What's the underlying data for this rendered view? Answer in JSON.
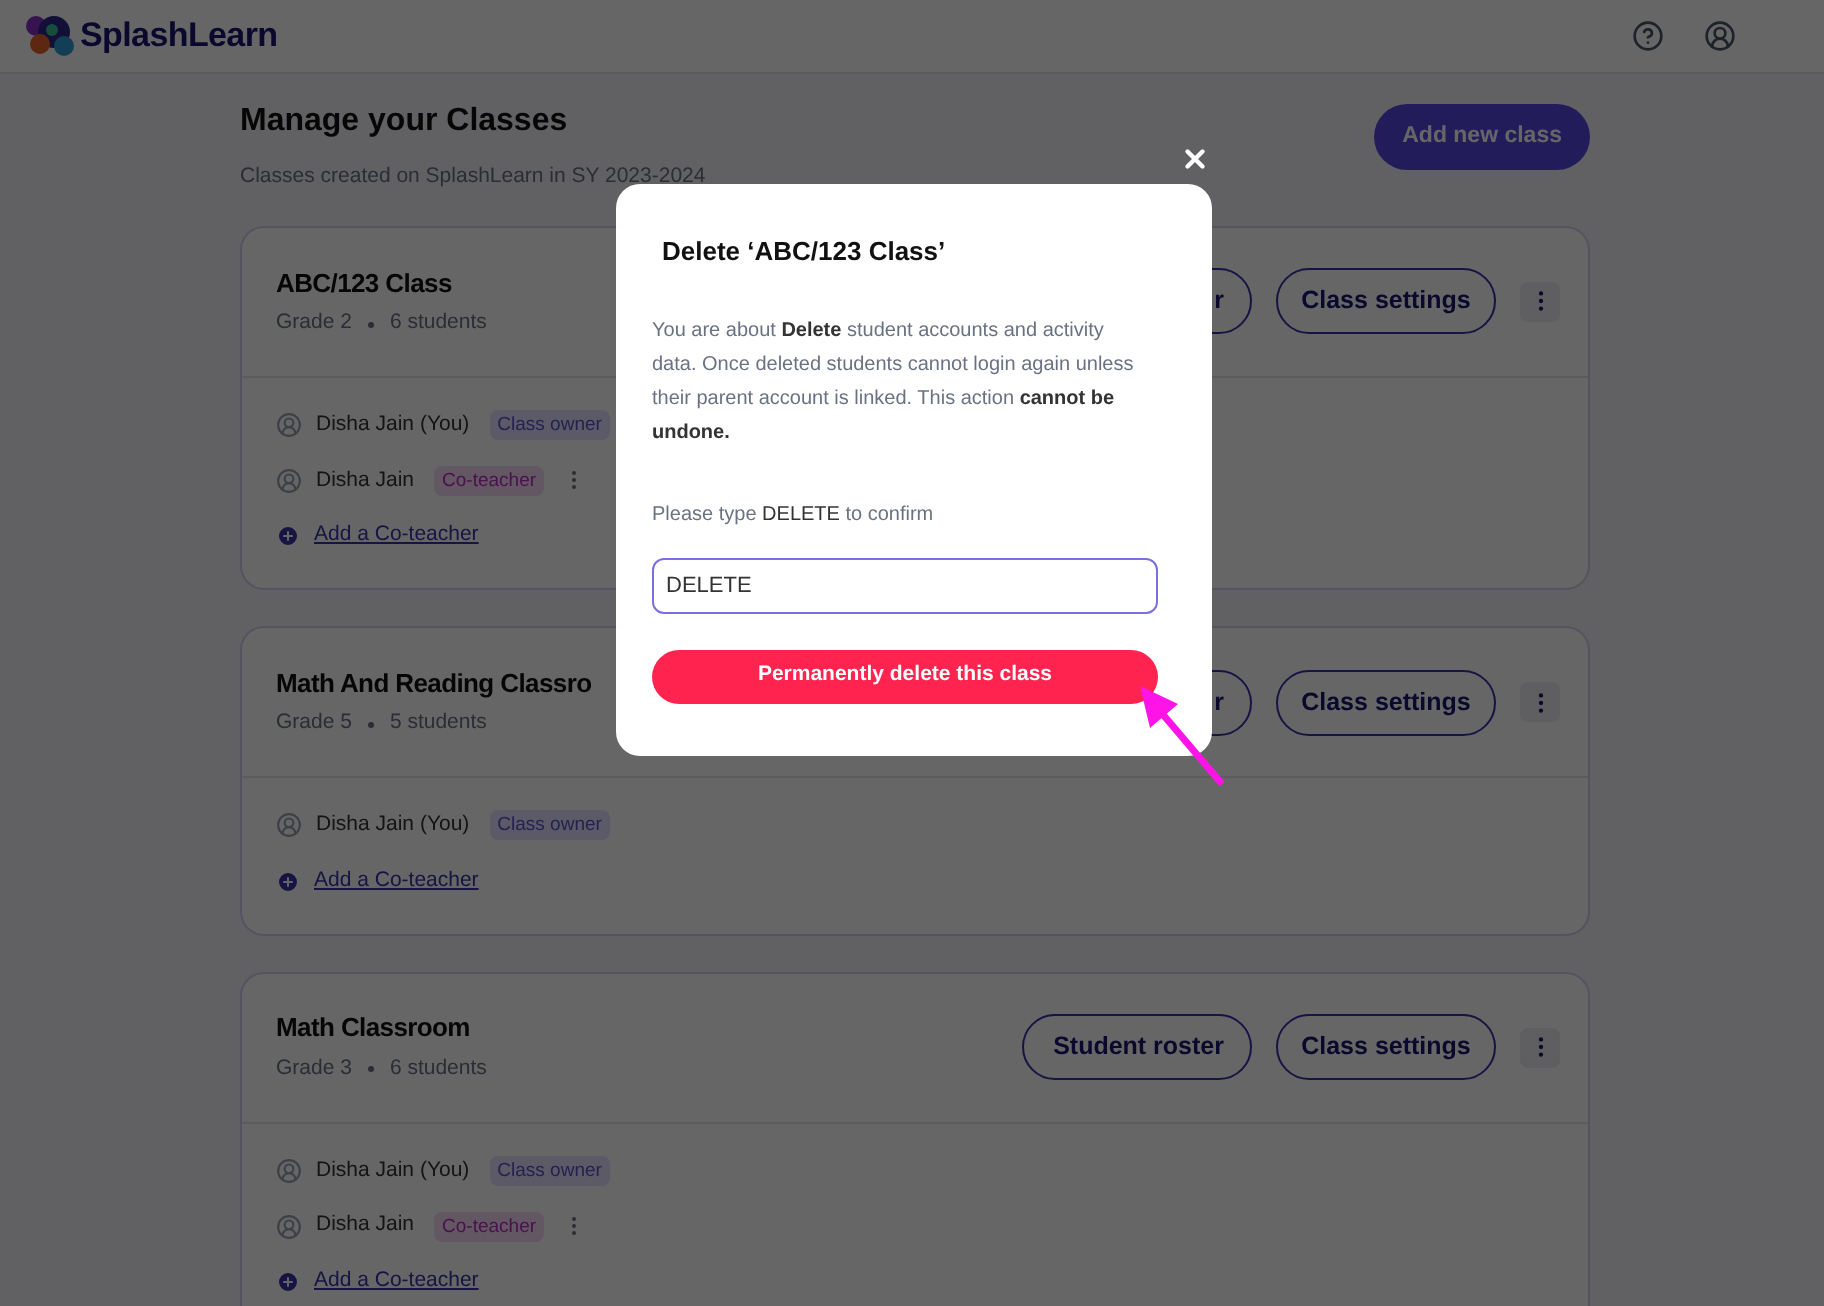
{
  "header": {
    "brand": "SplashLearn"
  },
  "page": {
    "title": "Manage your Classes",
    "subtitle": "Classes created on SplashLearn in SY 2023-2024",
    "add_button": "Add new class"
  },
  "classes": [
    {
      "name": "ABC/123 Class",
      "grade": "Grade 2",
      "students": "6 students",
      "roster_button": "r",
      "settings_button": "Class settings",
      "teachers": [
        {
          "name": "Disha Jain (You)",
          "role": "Class owner",
          "kind": "owner"
        },
        {
          "name": "Disha Jain",
          "role": "Co-teacher",
          "kind": "co"
        }
      ],
      "add_link": "Add a Co-teacher"
    },
    {
      "name": "Math And Reading Classro",
      "grade": "Grade 5",
      "students": "5 students",
      "roster_button": "r",
      "settings_button": "Class settings",
      "teachers": [
        {
          "name": "Disha Jain (You)",
          "role": "Class owner",
          "kind": "owner"
        }
      ],
      "add_link": "Add a Co-teacher"
    },
    {
      "name": "Math Classroom",
      "grade": "Grade 3",
      "students": "6 students",
      "roster_button": "Student roster",
      "settings_button": "Class settings",
      "teachers": [
        {
          "name": "Disha Jain (You)",
          "role": "Class owner",
          "kind": "owner"
        },
        {
          "name": "Disha Jain",
          "role": "Co-teacher",
          "kind": "co"
        }
      ],
      "add_link": "Add a Co-teacher"
    }
  ],
  "dialog": {
    "title": "Delete ‘ABC/123 Class’",
    "body": "You are about **Delete** student accounts and activity data. Once deleted students cannot login again unless their parent account is linked. This action **cannot be undone.**",
    "prompt": "Please type **DELETE** to confirm",
    "input_value": "DELETE",
    "confirm_button": "Permanently delete this class"
  }
}
